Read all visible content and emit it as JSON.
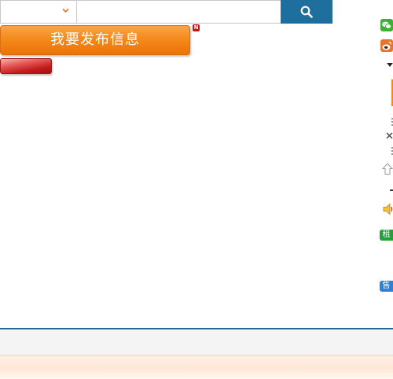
{
  "search": {
    "category_value": "",
    "placeholder": "",
    "button_icon": "search-icon"
  },
  "publish": {
    "label": "我要发布信息",
    "badge": "N"
  },
  "sidebar": {
    "rent_label": "租",
    "sale_label": "售",
    "icons": [
      "wechat-icon",
      "weibo-icon",
      "caret-down-icon",
      "close-icon",
      "arrow-up-icon",
      "speaker-icon"
    ]
  },
  "colors": {
    "search_button": "#1e6e9e",
    "publish_button": "#f48a1c",
    "rent_badge": "#23a03a",
    "sale_badge": "#2a83d6",
    "footer_border": "#1e6e9e"
  }
}
